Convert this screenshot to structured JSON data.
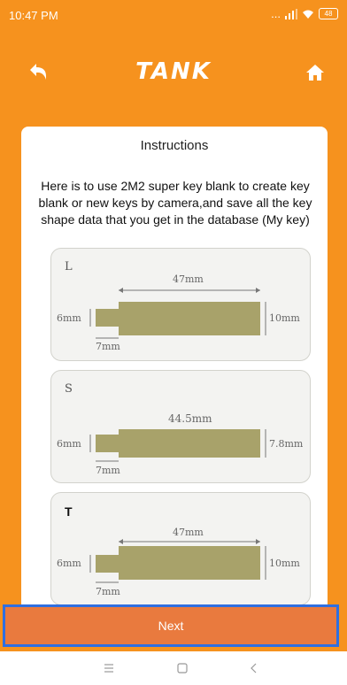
{
  "status_bar": {
    "time": "10:47 PM",
    "signal": "...",
    "battery": "48"
  },
  "header": {
    "title": "TANK"
  },
  "card": {
    "title": "Instructions",
    "description": "Here is to use 2M2 super key blank to create key blank or new keys by camera,and save all the key shape data that you get in the database (My key)"
  },
  "keys": [
    {
      "size": "L",
      "length": "47mm",
      "tip_height": "6mm",
      "tip_length": "7mm",
      "body_height": "10mm"
    },
    {
      "size": "S",
      "length": "44.5mm",
      "tip_height": "6mm",
      "tip_length": "7mm",
      "body_height": "7.8mm"
    },
    {
      "size": "T",
      "length": "47mm",
      "tip_height": "6mm",
      "tip_length": "7mm",
      "body_height": "10mm"
    }
  ],
  "next_button": {
    "label": "Next"
  },
  "colors": {
    "primary": "#f6921e",
    "button": "#e97a3e",
    "highlight": "#2f6fe0",
    "key_fill": "#a8a26a"
  },
  "nav_bar": {
    "icons": [
      "menu-icon",
      "home-square-icon",
      "back-triangle-icon"
    ]
  }
}
